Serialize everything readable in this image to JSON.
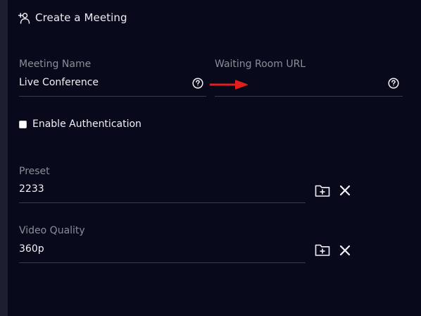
{
  "header": {
    "title": "Create a Meeting",
    "icon": "add-user-icon"
  },
  "meeting_name": {
    "label": "Meeting Name",
    "value": "Live Conference",
    "help_icon": "help-icon"
  },
  "waiting_room": {
    "label": "Waiting Room URL",
    "value": "",
    "help_icon": "help-icon"
  },
  "annotation": {
    "icon": "red-arrow-icon",
    "color": "#e21e1e"
  },
  "authentication": {
    "label": "Enable Authentication",
    "checked": false
  },
  "preset": {
    "label": "Preset",
    "value": "2233",
    "actions": [
      "folder-add-icon",
      "close-icon"
    ]
  },
  "video_quality": {
    "label": "Video Quality",
    "value": "360p",
    "actions": [
      "folder-add-icon",
      "close-icon"
    ]
  },
  "colors": {
    "background": "#080a1b",
    "label": "#8b8d97",
    "text": "#f1f1f5",
    "divider": "#3a3c4b"
  }
}
